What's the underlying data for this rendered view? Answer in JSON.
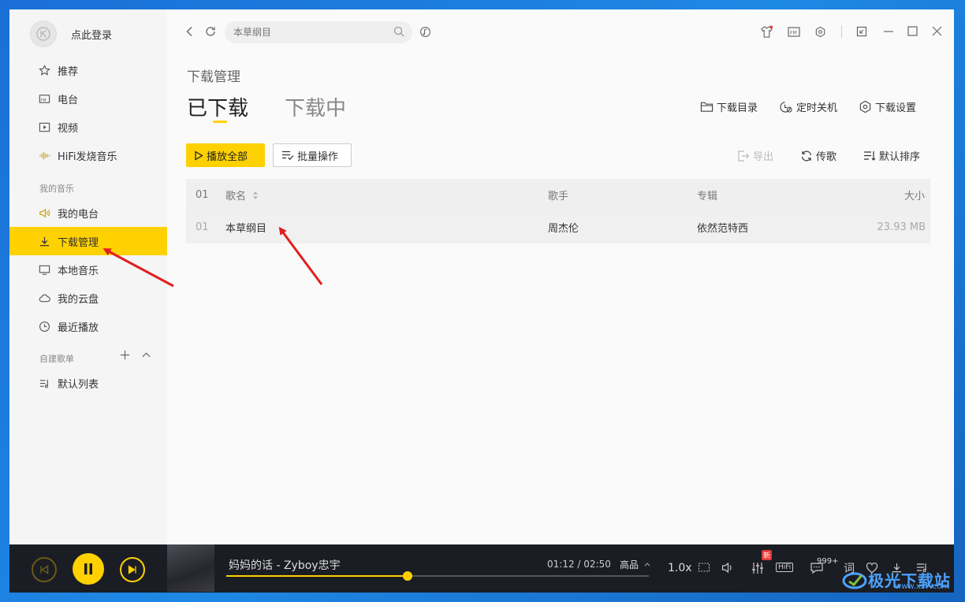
{
  "colors": {
    "accent": "#ffd100",
    "arrow": "#e02020",
    "sidebar_bg": "#f5f5f5",
    "player_bg": "#1b1d24"
  },
  "sidebar": {
    "login_label": "点此登录",
    "items": [
      {
        "label": "推荐",
        "icon": "star-icon"
      },
      {
        "label": "电台",
        "icon": "radio-icon"
      },
      {
        "label": "视频",
        "icon": "video-icon"
      },
      {
        "label": "HiFi发烧音乐",
        "icon": "soundwave-icon"
      }
    ],
    "my_music_label": "我的音乐",
    "my_music": [
      {
        "label": "我的电台",
        "icon": "speaker-icon"
      },
      {
        "label": "下载管理",
        "icon": "download-icon"
      },
      {
        "label": "本地音乐",
        "icon": "monitor-icon"
      },
      {
        "label": "我的云盘",
        "icon": "cloud-icon"
      },
      {
        "label": "最近播放",
        "icon": "clock-icon"
      }
    ],
    "playlists_label": "自建歌单",
    "playlists": [
      {
        "label": "默认列表",
        "icon": "playlist-icon"
      }
    ]
  },
  "search": {
    "placeholder": "本草纲目"
  },
  "main": {
    "page_title": "下载管理",
    "tabs": [
      {
        "label": "已下载"
      },
      {
        "label": "下载中"
      }
    ],
    "top_actions": [
      "下载目录",
      "定时关机",
      "下载设置"
    ],
    "play_all": "播放全部",
    "batch": "批量操作",
    "export": "导出",
    "upload": "传歌",
    "sort": "默认排序",
    "table": {
      "headers": {
        "num": "01",
        "name": "歌名",
        "artist": "歌手",
        "album": "专辑",
        "size": "大小"
      },
      "rows": [
        {
          "num": "01",
          "name": "本草纲目",
          "artist": "周杰伦",
          "album": "依然范特西",
          "size": "23.93 MB"
        }
      ]
    }
  },
  "player": {
    "song": "妈妈的话 - Zyboy忠宇",
    "time": "01:12 / 02:50",
    "progress": 0.43,
    "quality": "高品",
    "speed": "1.0x",
    "hifi": "HiFi",
    "new_badge": "新",
    "comment_count": "999+",
    "lyrics": "词"
  },
  "watermark": {
    "text": "极光下载站",
    "url": "www.xz7.com"
  }
}
